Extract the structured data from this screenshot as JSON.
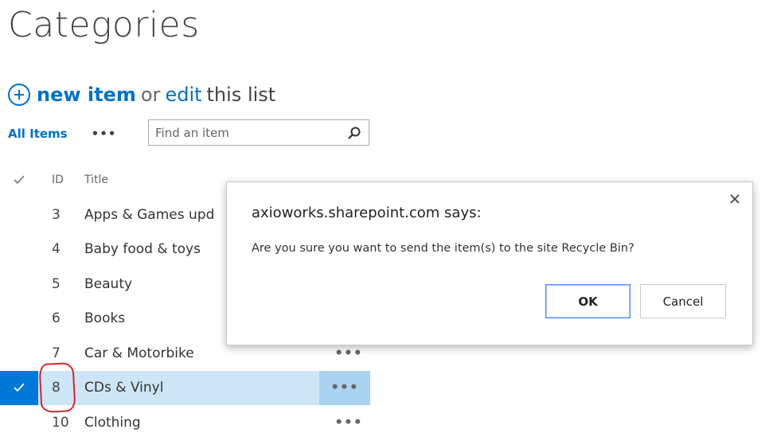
{
  "page": {
    "title": "Categories"
  },
  "commands": {
    "new_item": "new item",
    "or": "or",
    "edit": "edit",
    "this_list": "this list"
  },
  "view": {
    "all_items": "All Items",
    "more": "•••",
    "search_placeholder": "Find an item"
  },
  "list": {
    "headers": {
      "id": "ID",
      "title": "Title"
    },
    "rows": [
      {
        "id": "3",
        "title": "Apps & Games upd"
      },
      {
        "id": "4",
        "title": "Baby food & toys"
      },
      {
        "id": "5",
        "title": "Beauty"
      },
      {
        "id": "6",
        "title": "Books"
      },
      {
        "id": "7",
        "title": "Car & Motorbike",
        "actions": "•••"
      },
      {
        "id": "8",
        "title": "CDs & Vinyl",
        "actions": "•••",
        "selected": true
      },
      {
        "id": "10",
        "title": "Clothing",
        "actions": "•••"
      }
    ]
  },
  "dialog": {
    "title": "axioworks.sharepoint.com says:",
    "message": "Are you sure you want to send the item(s) to the site Recycle Bin?",
    "ok": "OK",
    "cancel": "Cancel"
  },
  "colors": {
    "accent": "#0072c6",
    "selected_row": "#cde6f7",
    "selected_check": "#0078d7",
    "annotation": "#e0202a"
  }
}
